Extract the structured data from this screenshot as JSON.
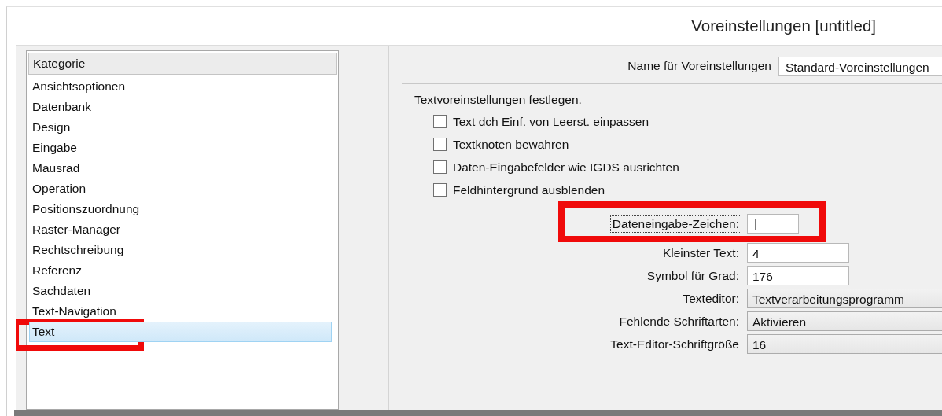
{
  "window": {
    "title": "Voreinstellungen [untitled]"
  },
  "category_list": {
    "header": "Kategorie",
    "items": [
      {
        "label": "Ansichtsoptionen",
        "selected": false
      },
      {
        "label": "Datenbank",
        "selected": false
      },
      {
        "label": "Design",
        "selected": false
      },
      {
        "label": "Eingabe",
        "selected": false
      },
      {
        "label": "Mausrad",
        "selected": false
      },
      {
        "label": "Operation",
        "selected": false
      },
      {
        "label": "Positionszuordnung",
        "selected": false
      },
      {
        "label": "Raster-Manager",
        "selected": false
      },
      {
        "label": "Rechtschreibung",
        "selected": false
      },
      {
        "label": "Referenz",
        "selected": false
      },
      {
        "label": "Sachdaten",
        "selected": false
      },
      {
        "label": "Text-Navigation",
        "selected": false
      },
      {
        "label": "Text",
        "selected": true
      }
    ]
  },
  "preset_name": {
    "label": "Name für Voreinstellungen",
    "value": "Standard-Voreinstellungen"
  },
  "section_title": "Textvoreinstellungen festlegen.",
  "checkboxes": [
    {
      "label": "Text dch Einf. von Leerst. einpassen",
      "checked": false
    },
    {
      "label": "Textknoten bewahren",
      "checked": false
    },
    {
      "label": "Daten-Eingabefelder wie IGDS ausrichten",
      "checked": false
    },
    {
      "label": "Feldhintergrund ausblenden",
      "checked": false
    }
  ],
  "fields": [
    {
      "kind": "char",
      "label": "Dateneingabe-Zeichen:",
      "value": "⌋",
      "focused": true
    },
    {
      "kind": "text",
      "label": "Kleinster Text:",
      "value": "4",
      "focused": false
    },
    {
      "kind": "text",
      "label": "Symbol für Grad:",
      "value": "176",
      "focused": false
    },
    {
      "kind": "dropdown",
      "label": "Texteditor:",
      "value": "Textverarbeitungsprogramm",
      "focused": false
    },
    {
      "kind": "dropdown",
      "label": "Fehlende Schriftarten:",
      "value": "Aktivieren",
      "focused": false
    },
    {
      "kind": "dropdown",
      "label": "Text-Editor-Schriftgröße",
      "value": "16",
      "focused": false
    }
  ]
}
